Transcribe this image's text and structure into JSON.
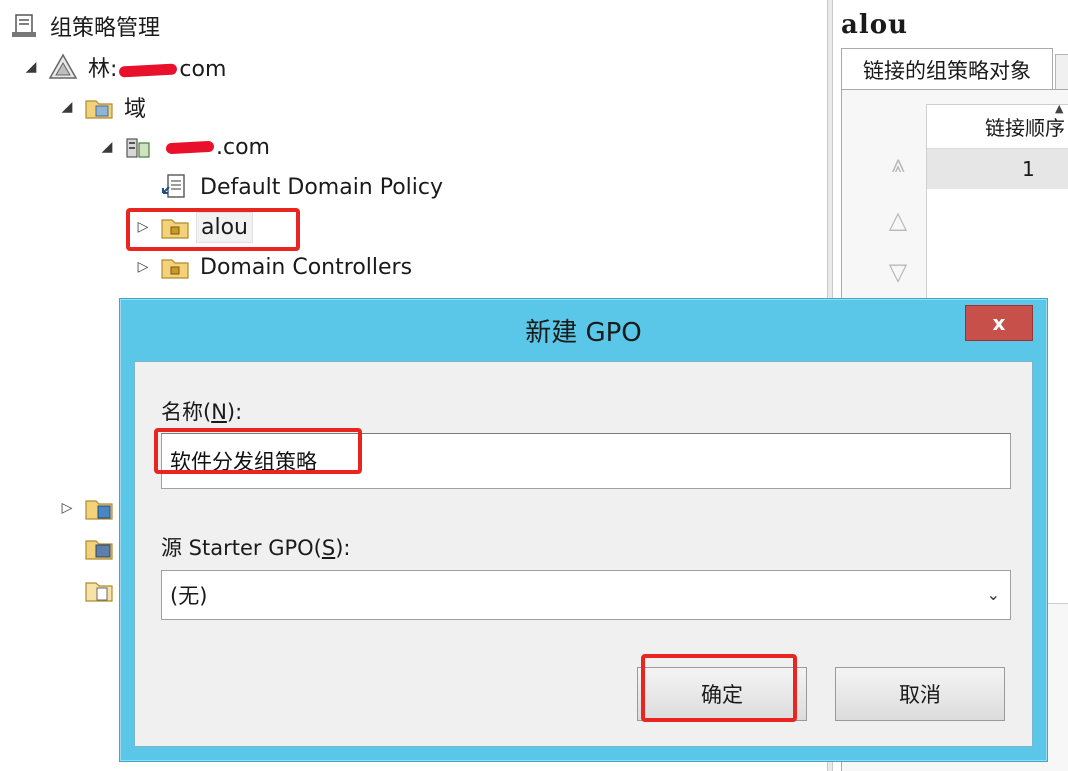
{
  "tree": {
    "root": {
      "label": "组策略管理",
      "icon": "gpm-console-icon"
    },
    "forest": {
      "prefix": "林:",
      "suffix": "com",
      "icon": "forest-icon"
    },
    "domains": {
      "label": "域",
      "icon": "domains-folder-icon"
    },
    "domain": {
      "suffix": ".com",
      "icon": "domain-icon"
    },
    "default_policy": {
      "label": "Default Domain Policy",
      "icon": "gpo-link-icon"
    },
    "ou_alou": {
      "label": "alou",
      "icon": "ou-folder-icon"
    },
    "ou_dc": {
      "label": "Domain Controllers",
      "icon": "ou-folder-icon"
    }
  },
  "right_pane": {
    "title": "alou",
    "tab_label": "链接的组策略对象",
    "column_header": "链接顺序",
    "row_value": "1"
  },
  "dialog": {
    "title": "新建 GPO",
    "close_label": "x",
    "name_label_prefix": "名称(",
    "name_label_key": "N",
    "name_label_suffix": "):",
    "name_value": "软件分发组策略",
    "source_label_prefix": "源 Starter GPO(",
    "source_label_key": "S",
    "source_label_suffix": "):",
    "source_selected": "(无)",
    "ok_label": "确定",
    "cancel_label": "取消"
  },
  "colors": {
    "dialog_frame": "#5ac6e8",
    "close_button": "#c7504b",
    "annotation_red": "#e8251f"
  }
}
